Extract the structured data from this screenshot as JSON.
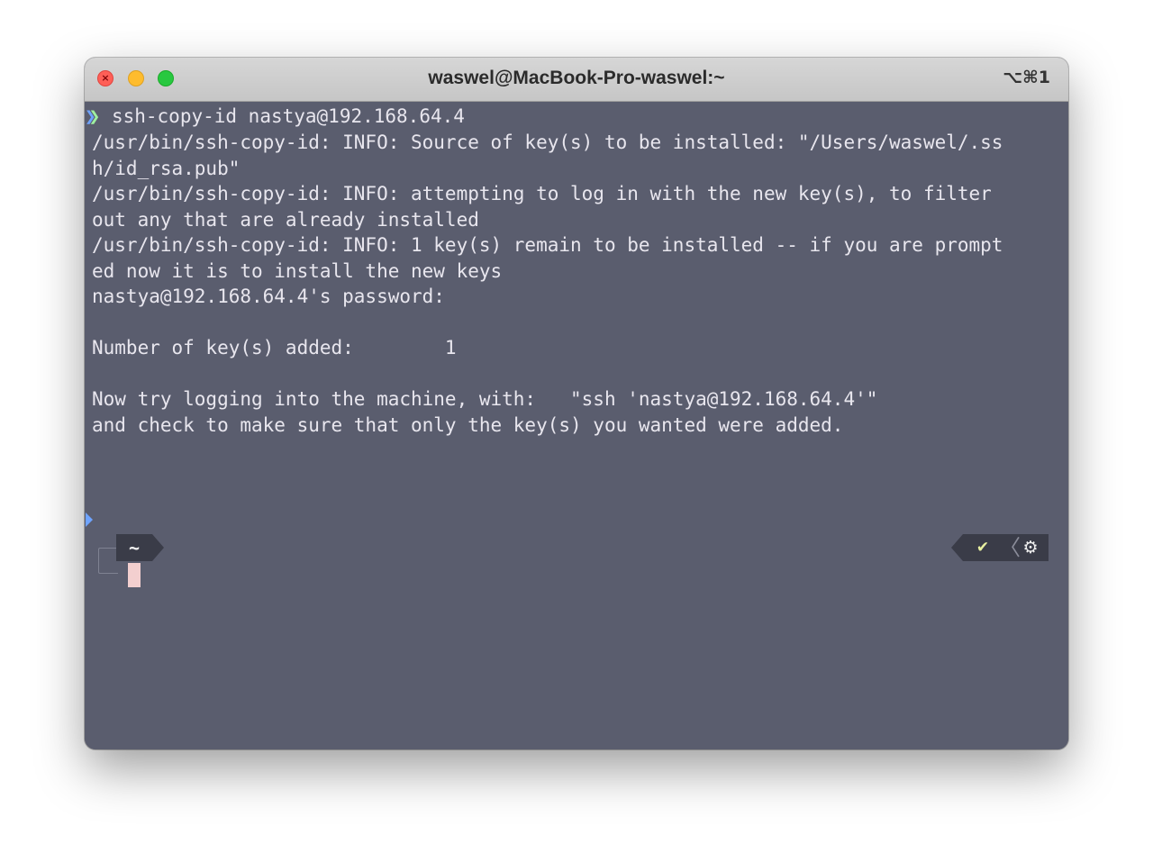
{
  "window": {
    "title": "waswel@MacBook-Pro-waswel:~",
    "shortcut": "⌥⌘1",
    "close_glyph": "×"
  },
  "terminal": {
    "prompt_arrow_1": "❯",
    "prompt_arrow_2": "❯",
    "command": " ssh-copy-id nastya@192.168.64.4",
    "output_lines": [
      "/usr/bin/ssh-copy-id: INFO: Source of key(s) to be installed: \"/Users/waswel/.ss",
      "h/id_rsa.pub\"",
      "/usr/bin/ssh-copy-id: INFO: attempting to log in with the new key(s), to filter",
      "out any that are already installed",
      "/usr/bin/ssh-copy-id: INFO: 1 key(s) remain to be installed -- if you are prompt",
      "ed now it is to install the new keys",
      "nastya@192.168.64.4's password:",
      "",
      "Number of key(s) added:        1",
      "",
      "Now try logging into the machine, with:   \"ssh 'nastya@192.168.64.4'\"",
      "and check to make sure that only the key(s) you wanted were added."
    ]
  },
  "prompt": {
    "directory": "~",
    "status_icon": "check-icon",
    "status_glyph": "✔",
    "separator_glyph": "〈",
    "settings_icon": "gear-icon",
    "settings_glyph": "⚙"
  },
  "colors": {
    "terminal_background": "#5a5d6e",
    "terminal_text": "#e8e6ee",
    "titlebar": "#cfcfcf",
    "prompt_segment": "#3a3c48",
    "cursor": "#f3cfcf",
    "arrow_green": "#9ff0a0",
    "arrow_blue": "#6fa4ff"
  }
}
